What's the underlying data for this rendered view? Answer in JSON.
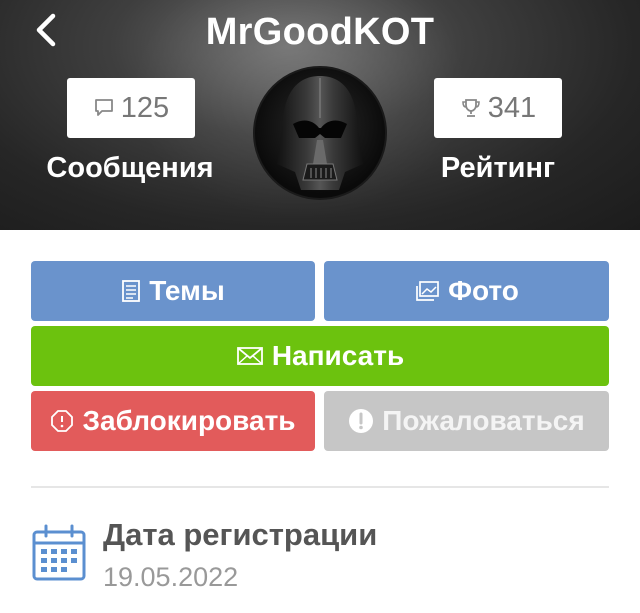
{
  "header": {
    "title": "MrGoodKOT",
    "back_icon": "chevron-left-icon",
    "avatar_icon": "darth-vader-helmet"
  },
  "stats": {
    "messages": {
      "value": "125",
      "label": "Сообщения",
      "icon": "comment-icon"
    },
    "rating": {
      "value": "341",
      "label": "Рейтинг",
      "icon": "trophy-icon"
    }
  },
  "actions": {
    "topics": {
      "label": "Темы",
      "icon": "document-icon",
      "color": "#6a93cc"
    },
    "photo": {
      "label": "Фото",
      "icon": "photos-icon",
      "color": "#6a93cc"
    },
    "write": {
      "label": "Написать",
      "icon": "envelope-icon",
      "color": "#6cc20e"
    },
    "block": {
      "label": "Заблокировать",
      "icon": "octagon-warning-icon",
      "color": "#e25b5b"
    },
    "report": {
      "label": "Пожаловаться",
      "icon": "exclamation-circle-icon",
      "color": "#c6c6c6"
    }
  },
  "registration": {
    "title": "Дата регистрации",
    "date": "19.05.2022",
    "icon": "calendar-icon",
    "icon_color": "#5b8fd0"
  }
}
